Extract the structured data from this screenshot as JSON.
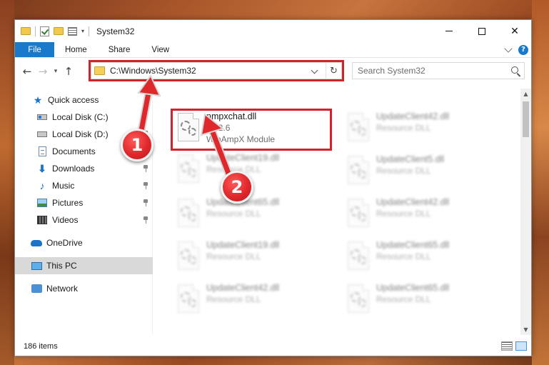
{
  "window": {
    "title": "System32",
    "controls": {
      "minimize": "",
      "maximize": "",
      "close": "✕"
    }
  },
  "ribbon": {
    "tabs": [
      {
        "label": "File"
      },
      {
        "label": "Home"
      },
      {
        "label": "Share"
      },
      {
        "label": "View"
      }
    ],
    "help_label": "?"
  },
  "addressbar": {
    "path": "C:\\Windows\\System32",
    "search_placeholder": "Search System32"
  },
  "sidebar": {
    "items": [
      {
        "label": "Quick access",
        "icon": "star-icon",
        "pinned": false
      },
      {
        "label": "Local Disk (C:)",
        "icon": "drive-icon",
        "pinned": true
      },
      {
        "label": "Local Disk (D:)",
        "icon": "drive-icon",
        "pinned": true
      },
      {
        "label": "Documents",
        "icon": "documents-icon",
        "pinned": true
      },
      {
        "label": "Downloads",
        "icon": "download-icon",
        "pinned": true
      },
      {
        "label": "Music",
        "icon": "music-icon",
        "pinned": true
      },
      {
        "label": "Pictures",
        "icon": "pictures-icon",
        "pinned": true
      },
      {
        "label": "Videos",
        "icon": "videos-icon",
        "pinned": true
      },
      {
        "label": "OneDrive",
        "icon": "onedrive-icon",
        "pinned": false
      },
      {
        "label": "This PC",
        "icon": "this-pc-icon",
        "pinned": false,
        "selected": true
      },
      {
        "label": "Network",
        "icon": "network-icon",
        "pinned": false
      }
    ]
  },
  "files": {
    "highlighted": {
      "name": "nmpxchat.dll",
      "version": "10.2.6",
      "description": "WinAmpX Module"
    },
    "column1": [
      {
        "name": "UpdateClient19.dll",
        "type": "Resource DLL"
      },
      {
        "name": "UpdateClient65.dll",
        "type": "Resource DLL"
      },
      {
        "name": "UpdateClient19.dll",
        "type": "Resource DLL"
      },
      {
        "name": "UpdateClient42.dll",
        "type": "Resource DLL"
      }
    ],
    "column2": [
      {
        "name": "UpdateClient42.dll",
        "type": "Resource DLL"
      },
      {
        "name": "UpdateClient5.dll",
        "type": "Resource DLL"
      },
      {
        "name": "UpdateClient42.dll",
        "type": "Resource DLL"
      },
      {
        "name": "UpdateClient65.dll",
        "type": "Resource DLL"
      },
      {
        "name": "UpdateClient65.dll",
        "type": "Resource DLL"
      }
    ]
  },
  "statusbar": {
    "item_count": "186 items"
  },
  "annotations": [
    {
      "number": "1",
      "target": "address-bar"
    },
    {
      "number": "2",
      "target": "nmpxchat-file"
    }
  ],
  "colors": {
    "accent": "#1979ca",
    "highlight": "#d0242a",
    "selected": "#d9d9d9"
  }
}
